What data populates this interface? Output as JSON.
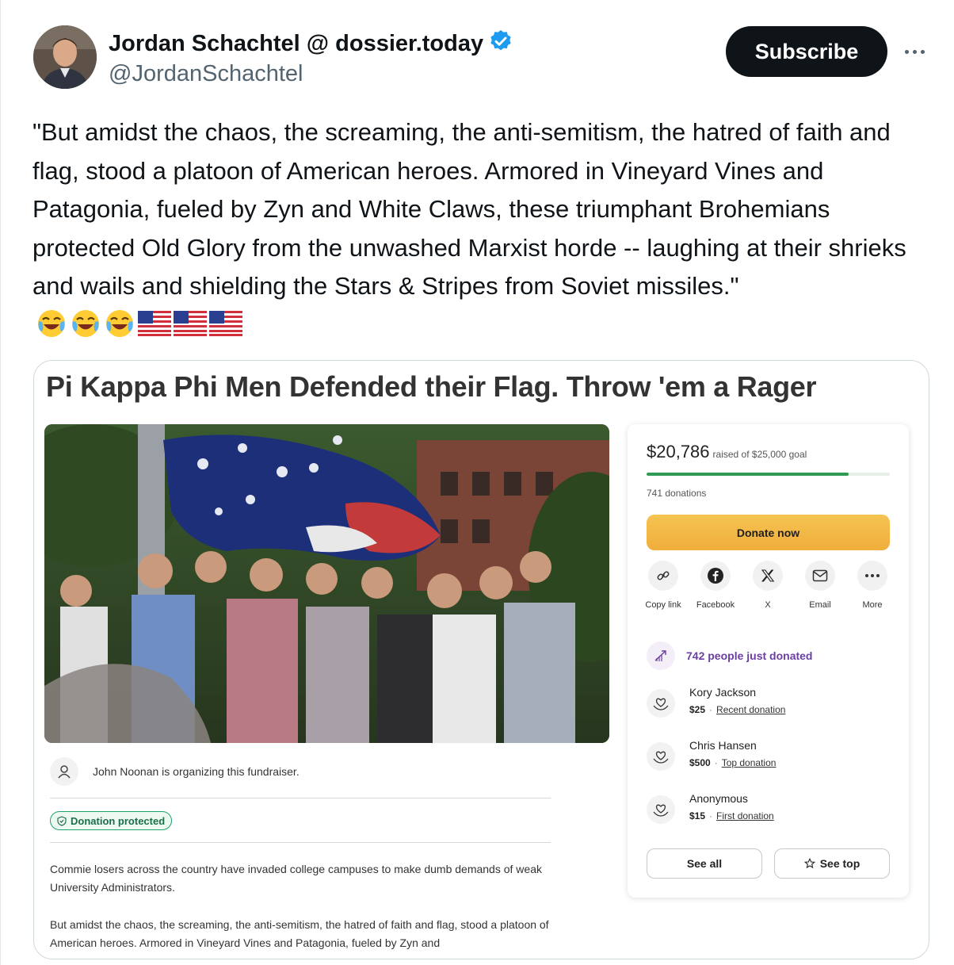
{
  "author": {
    "name": "Jordan Schachtel @ dossier.today",
    "handle": "@JordanSchachtel",
    "subscribe_label": "Subscribe"
  },
  "tweet": {
    "text": "\"But amidst the chaos, the screaming, the anti-semitism, the hatred of faith and flag, stood a platoon of American heroes. Armored in Vineyard Vines and Patagonia, fueled by Zyn and White Claws, these triumphant Brohemians protected Old Glory from the unwashed Marxist horde -- laughing at their shrieks and wails and shielding the Stars & Stripes from Soviet missiles.\"",
    "emojis": [
      "face-with-tears-of-joy",
      "face-with-tears-of-joy",
      "face-with-tears-of-joy",
      "us-flag",
      "us-flag",
      "us-flag"
    ]
  },
  "card": {
    "title": "Pi Kappa Phi Men Defended their Flag. Throw 'em a Rager",
    "organizer_text": "John Noonan is organizing this fundraiser.",
    "protected_label": "Donation protected",
    "story": [
      "Commie losers across the country have invaded college campuses to make dumb demands of weak University Administrators.",
      "But amidst the chaos, the screaming, the anti-semitism, the hatred of faith and flag, stood a platoon of American heroes. Armored in Vineyard Vines and Patagonia, fueled by Zyn and"
    ],
    "panel": {
      "raised_amount": "$20,786",
      "raised_goal": "raised of $25,000 goal",
      "progress_fraction": 0.83,
      "donations_count": "741 donations",
      "donate_label": "Donate now",
      "share": [
        {
          "icon": "link-icon",
          "label": "Copy link"
        },
        {
          "icon": "facebook-icon",
          "label": "Facebook"
        },
        {
          "icon": "x-icon",
          "label": "X"
        },
        {
          "icon": "email-icon",
          "label": "Email"
        },
        {
          "icon": "more-icon",
          "label": "More"
        }
      ],
      "just_donated": "742 people just donated",
      "donors": [
        {
          "name": "Kory Jackson",
          "amount": "$25",
          "tag": "Recent donation"
        },
        {
          "name": "Chris Hansen",
          "amount": "$500",
          "tag": "Top donation"
        },
        {
          "name": "Anonymous",
          "amount": "$15",
          "tag": "First donation"
        }
      ],
      "see_all_label": "See all",
      "see_top_label": "See top"
    }
  },
  "colors": {
    "verified_badge": "#1d9bf0",
    "donate_button": "#f0ad3c",
    "progress": "#2f9a53",
    "just_donated": "#6b3fa0"
  }
}
